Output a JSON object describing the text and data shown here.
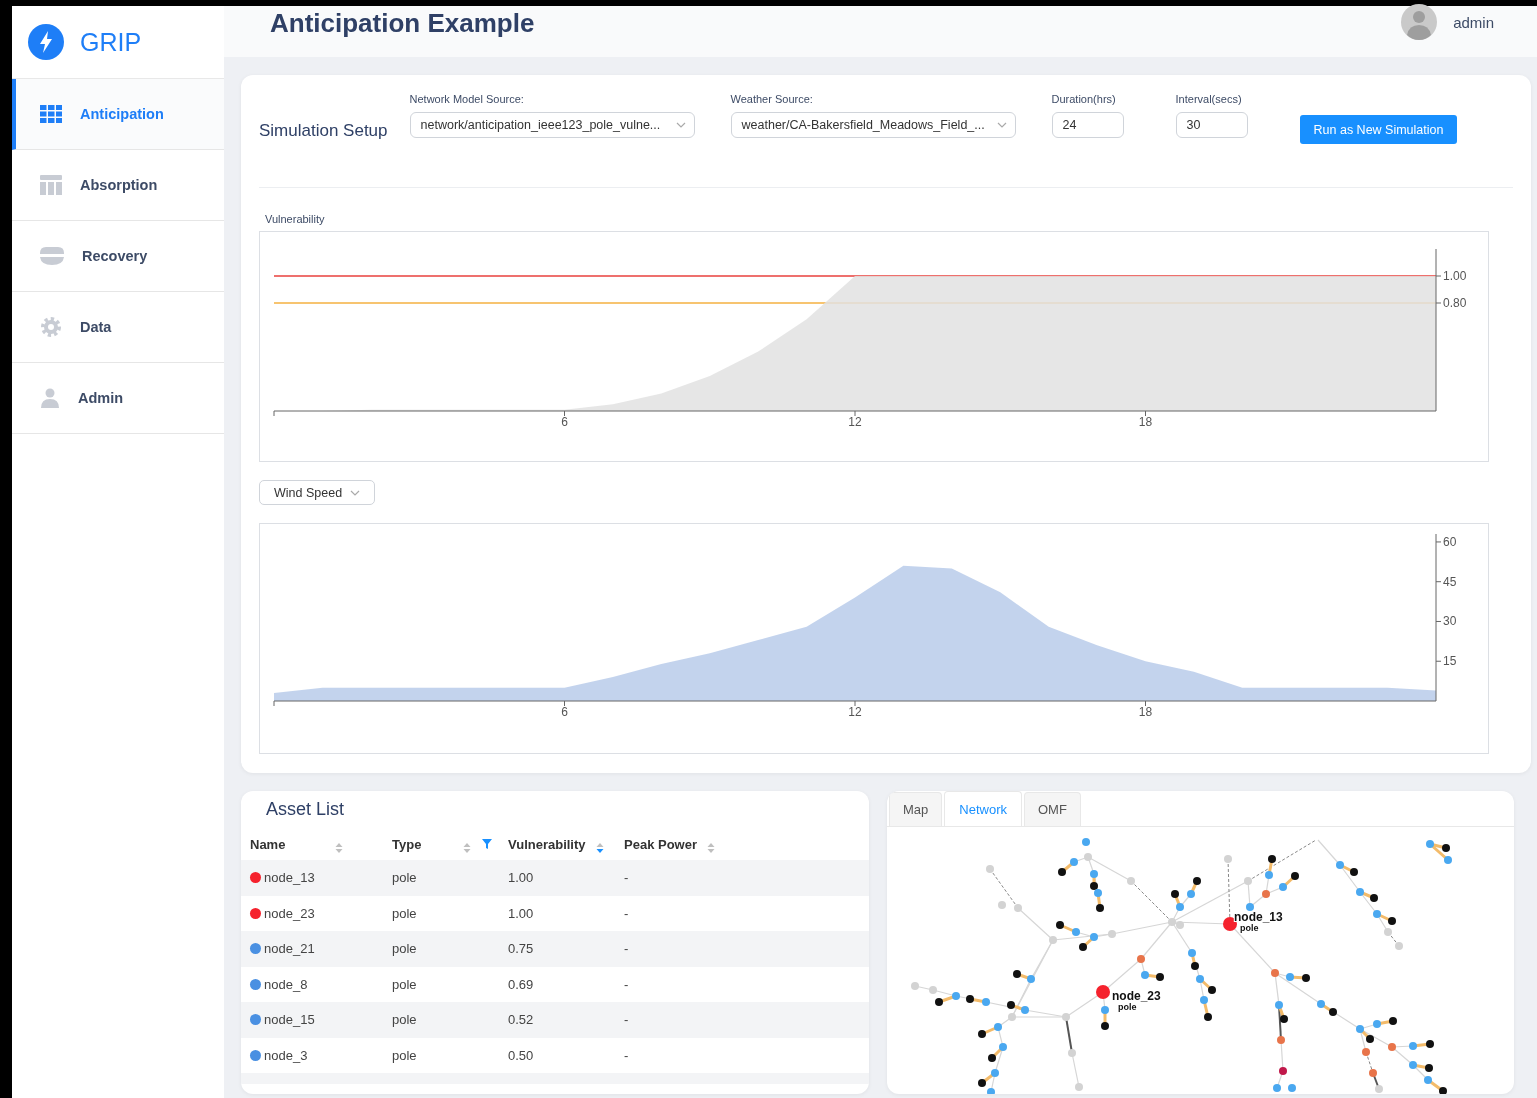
{
  "app": {
    "name": "GRIP"
  },
  "sidebar": {
    "items": [
      {
        "label": "Anticipation",
        "selected": true
      },
      {
        "label": "Absorption",
        "selected": false
      },
      {
        "label": "Recovery",
        "selected": false
      },
      {
        "label": "Data",
        "selected": false
      },
      {
        "label": "Admin",
        "selected": false
      }
    ]
  },
  "header": {
    "title": "Anticipation Example",
    "user": "admin"
  },
  "simulation_setup": {
    "title": "Simulation Setup",
    "fields": [
      {
        "kind": "select",
        "label": "Network Model Source:",
        "value": "network/anticipation_ieee123_pole_vulne..."
      },
      {
        "kind": "select",
        "label": "Weather Source:",
        "value": "weather/CA-Bakersfield_Meadows_Field_..."
      },
      {
        "kind": "input",
        "label": "Duration(hrs)",
        "value": "24"
      },
      {
        "kind": "input",
        "label": "Interval(secs)",
        "value": "30"
      }
    ],
    "button": "Run as New Simulation"
  },
  "vulnerability_chart": {
    "label": "Vulnerability",
    "chart_data": {
      "type": "area",
      "x": [
        0,
        1,
        2,
        3,
        4,
        5,
        6,
        7,
        8,
        9,
        10,
        11,
        12,
        13,
        14,
        15,
        16,
        17,
        18,
        19,
        20,
        21,
        22,
        23,
        24
      ],
      "series": [
        {
          "color": "#e2e2e2",
          "values": [
            0,
            0,
            0.01,
            0.01,
            0.01,
            0.01,
            0.01,
            0.05,
            0.13,
            0.26,
            0.44,
            0.68,
            1,
            1,
            1,
            1,
            1,
            1,
            1,
            1,
            1,
            1,
            1,
            1,
            1
          ]
        }
      ],
      "xlim": [
        0,
        24
      ],
      "ylim": [
        0,
        1.2
      ],
      "xticks": [
        6,
        12,
        18
      ],
      "yticks": [
        {
          "value": 1,
          "label": "1.00"
        },
        {
          "value": 0.8,
          "label": "0.80"
        }
      ],
      "ref_lines": [
        {
          "axis": "y",
          "value": 1,
          "color": "#e8413c"
        },
        {
          "axis": "y",
          "value": 0.8,
          "color": "#f5b041"
        }
      ]
    }
  },
  "wind_chart": {
    "selector": "Wind Speed",
    "chart_data": {
      "type": "area",
      "x": [
        0,
        1,
        2,
        3,
        4,
        5,
        6,
        7,
        8,
        9,
        10,
        11,
        12,
        13,
        14,
        15,
        16,
        17,
        18,
        19,
        20,
        21,
        22,
        23,
        24
      ],
      "series": [
        {
          "color": "#b8cbea",
          "values": [
            3,
            5,
            5,
            5,
            5,
            5,
            5,
            9,
            14,
            18,
            23,
            28,
            39,
            51,
            50,
            41,
            28,
            21,
            15,
            11,
            5,
            5,
            5,
            5,
            4
          ]
        }
      ],
      "xlim": [
        0,
        24
      ],
      "ylim": [
        0,
        63
      ],
      "xticks": [
        6,
        12,
        18
      ],
      "yticks": [
        15,
        30,
        45,
        60
      ]
    }
  },
  "asset_list": {
    "title": "Asset List",
    "columns": [
      {
        "label": "Name",
        "sorted_descending": false,
        "filtered": false
      },
      {
        "label": "Type",
        "sorted_descending": false,
        "filtered": true
      },
      {
        "label": "Vulnerability",
        "sorted_descending": true,
        "filtered": false
      },
      {
        "label": "Peak Power",
        "sorted_descending": false,
        "filtered": false
      }
    ],
    "rows": [
      {
        "color": "#f5222d",
        "cells": [
          "node_13",
          "pole",
          "1.00",
          "-"
        ]
      },
      {
        "color": "#f5222d",
        "cells": [
          "node_23",
          "pole",
          "1.00",
          "-"
        ]
      },
      {
        "color": "#4a90e2",
        "cells": [
          "node_21",
          "pole",
          "0.75",
          "-"
        ]
      },
      {
        "color": "#4a90e2",
        "cells": [
          "node_8",
          "pole",
          "0.69",
          "-"
        ]
      },
      {
        "color": "#4a90e2",
        "cells": [
          "node_15",
          "pole",
          "0.52",
          "-"
        ]
      },
      {
        "color": "#4a90e2",
        "cells": [
          "node_3",
          "pole",
          "0.50",
          "-"
        ]
      }
    ]
  },
  "network_panel": {
    "tabs": [
      {
        "label": "Map",
        "selected": false
      },
      {
        "label": "Network",
        "selected": true
      },
      {
        "label": "OMF",
        "selected": false
      }
    ],
    "node_labels": [
      {
        "name": "node_13",
        "type": "pole"
      },
      {
        "name": "node_23",
        "type": "pole"
      }
    ]
  }
}
